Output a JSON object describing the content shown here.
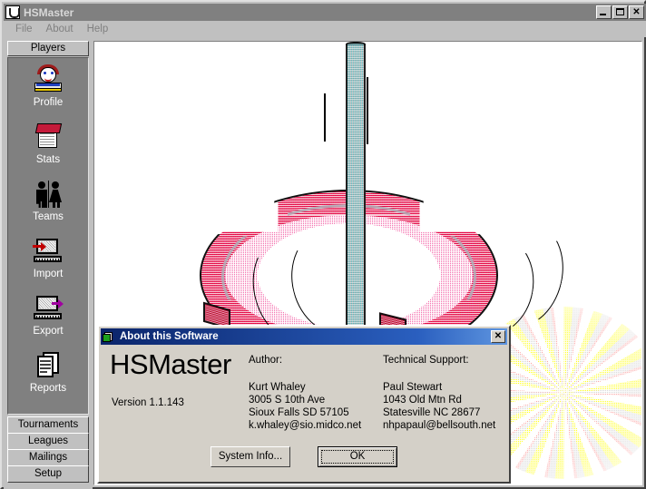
{
  "window": {
    "title": "HSMaster",
    "icon": "horseshoe-icon",
    "controls": {
      "minimize": "_",
      "maximize": "□",
      "close": "✕"
    }
  },
  "menu": {
    "items": [
      {
        "label": "File"
      },
      {
        "label": "About"
      },
      {
        "label": "Help"
      }
    ]
  },
  "sidebar": {
    "tab_label": "Players",
    "nav_items": [
      {
        "label": "Profile",
        "icon": "person-profile-icon"
      },
      {
        "label": "Stats",
        "icon": "notepad-stats-icon"
      },
      {
        "label": "Teams",
        "icon": "two-people-teams-icon"
      },
      {
        "label": "Import",
        "icon": "computer-import-icon"
      },
      {
        "label": "Export",
        "icon": "computer-export-icon"
      },
      {
        "label": "Reports",
        "icon": "documents-reports-icon"
      }
    ],
    "buttons": [
      {
        "label": "Tournaments"
      },
      {
        "label": "Leagues"
      },
      {
        "label": "Mailings"
      },
      {
        "label": "Setup"
      }
    ]
  },
  "artwork": {
    "description": "horseshoe-and-stake-illustration"
  },
  "dialog": {
    "title": "About this Software",
    "icon": "app-pages-icon",
    "close_label": "✕",
    "product_name": "HSMaster",
    "version": "Version 1.1.143",
    "author": {
      "heading": "Author:",
      "name": "Kurt Whaley",
      "street": "3005 S 10th Ave",
      "city": "Sioux Falls SD 57105",
      "email": "k.whaley@sio.midco.net"
    },
    "support": {
      "heading": "Technical Support:",
      "name": "Paul Stewart",
      "street": "1043 Old Mtn Rd",
      "city": "Statesville NC 28677",
      "email": "nhpapaul@bellsouth.net"
    },
    "buttons": {
      "system_info": "System Info...",
      "ok": "OK"
    }
  },
  "colors": {
    "face": "#c0c0c0",
    "dialog_face": "#d4d0c8",
    "inactive_title": "#808080",
    "active_title": "#0a246a",
    "panel_gray": "#808080",
    "horseshoe_red": "#d8143c",
    "stake_teal": "#8fb5b8",
    "glow_yellow": "#e6d200"
  }
}
